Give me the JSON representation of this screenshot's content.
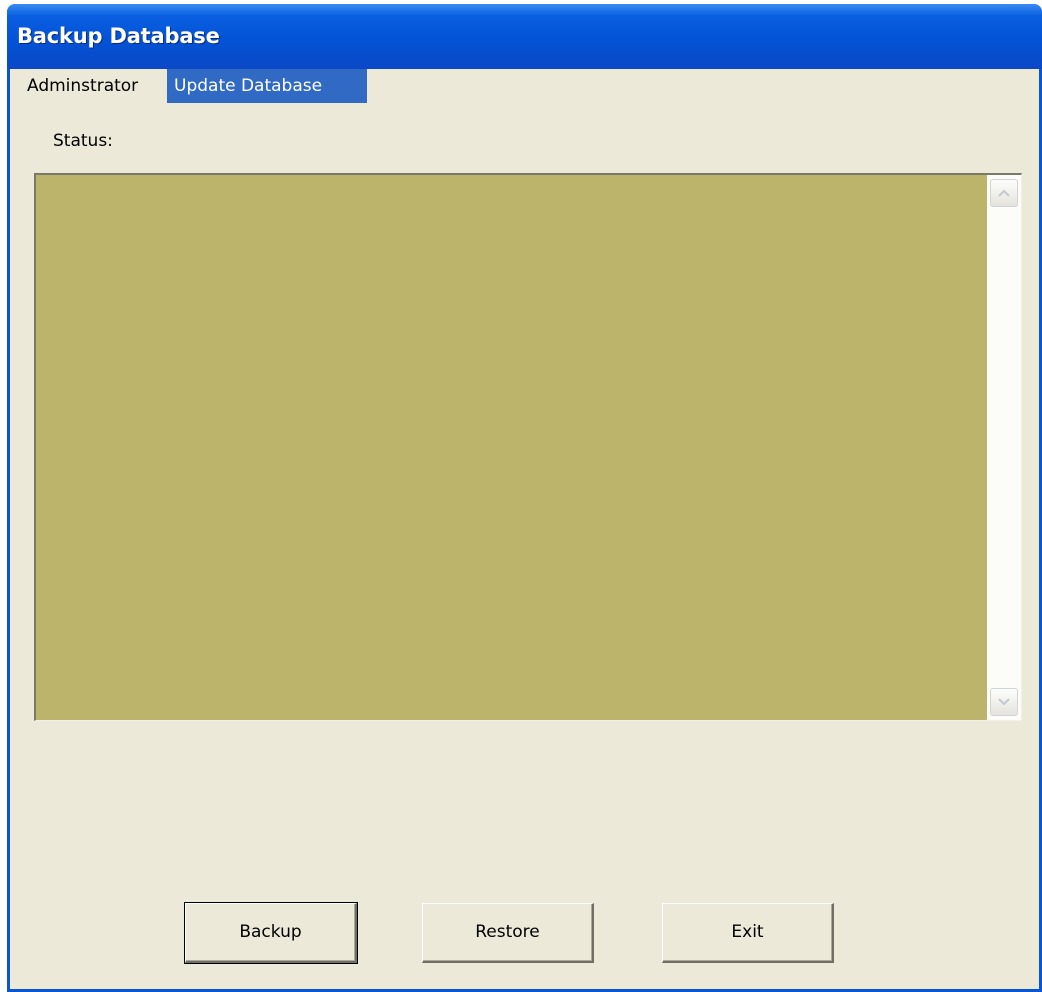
{
  "window": {
    "title": "Backup Database"
  },
  "menu": {
    "items": [
      {
        "label": "Adminstrator",
        "selected": false
      },
      {
        "label": "Update Database",
        "selected": true
      }
    ]
  },
  "status": {
    "label": "Status:",
    "value": ""
  },
  "buttons": {
    "backup": "Backup",
    "restore": "Restore",
    "exit": "Exit"
  },
  "colors": {
    "title_bar": "#0453d6",
    "menu_highlight": "#316ac5",
    "status_background": "#bdb46c",
    "dialog_background": "#ece9d8"
  }
}
